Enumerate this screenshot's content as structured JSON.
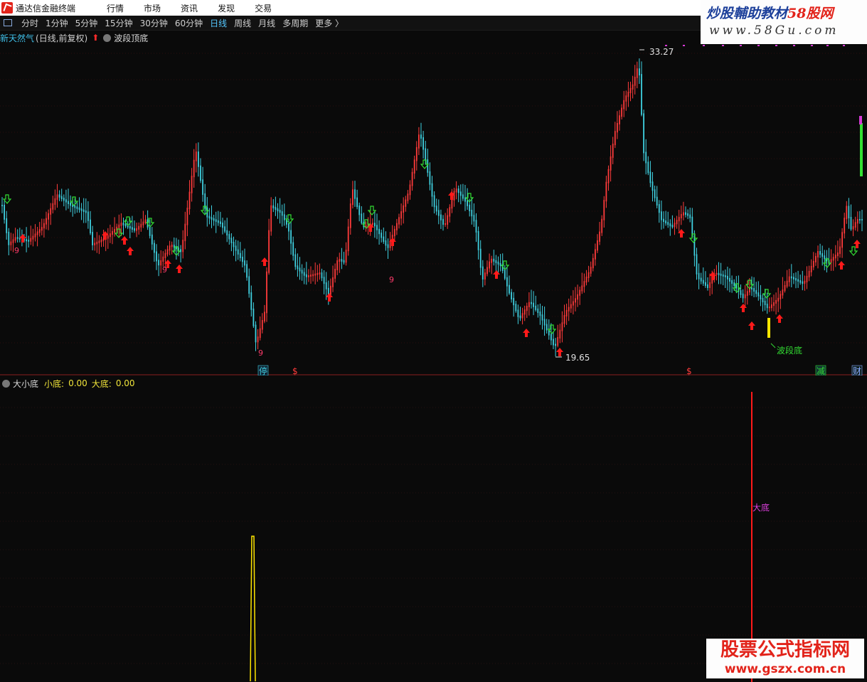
{
  "app": {
    "title": "通达信金融终端"
  },
  "menu": [
    "行情",
    "市场",
    "资讯",
    "发现",
    "交易"
  ],
  "periods": [
    "分时",
    "1分钟",
    "5分钟",
    "15分钟",
    "30分钟",
    "60分钟",
    "日线",
    "周线",
    "月线",
    "多周期",
    "更多 〉"
  ],
  "active_period": "日线",
  "watermark_top": {
    "line1_a": "炒股輔助教材",
    "line1_b": "58股网",
    "line2": "www.58Gu.com"
  },
  "watermark_bottom": {
    "line1": "股票公式指标网",
    "line2": "www.gszx.com.cn"
  },
  "main_chart": {
    "indicator": "新天然气",
    "sub": "(日线,前复权)",
    "overlay": "波段顶底",
    "high_label": "33.27",
    "low_label": "19.65",
    "bottom_label": "波段底",
    "event_markers": [
      "停",
      "$",
      "$",
      "减",
      "财"
    ],
    "colors": {
      "up": "#ff3b3b",
      "down": "#3fd0e0",
      "buy_arrow": "#ff1a1a",
      "sell_arrow": "#33dd33"
    }
  },
  "sub_chart": {
    "title": "大小底",
    "small_label": "小底:",
    "small_value": "0.00",
    "big_label": "大底:",
    "big_value": "0.00",
    "signal_label": "大底"
  }
}
